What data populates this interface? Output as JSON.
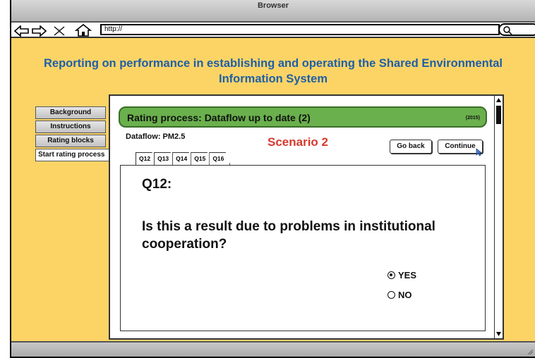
{
  "browser": {
    "title": "Browser",
    "url": "http://"
  },
  "page": {
    "heading": "Reporting on performance in establishing and operating the Shared Environmental Information System"
  },
  "sidebar": {
    "items": [
      {
        "label": "Background"
      },
      {
        "label": "Instructions"
      },
      {
        "label": "Rating blocks"
      },
      {
        "label": "Start rating process"
      }
    ]
  },
  "panel": {
    "banner_title": "Rating process: Dataflow up to date (2)",
    "banner_year": "(2015)",
    "dataflow": "Dataflow: PM2.5",
    "scenario": "Scenario 2",
    "go_back": "Go back",
    "continue": "Continue",
    "tabs": [
      "Q12",
      "Q13",
      "Q14",
      "Q15",
      "Q16"
    ],
    "question_label": "Q12:",
    "question_text": "Is this a result due to problems in institutional cooperation?",
    "options": [
      {
        "label": "YES",
        "selected": true
      },
      {
        "label": "NO",
        "selected": false
      }
    ]
  },
  "colors": {
    "page_bg": "#fcd466",
    "heading": "#1f5fa6",
    "banner": "#6ab04c",
    "scenario": "#d63a2f"
  },
  "icons": [
    "back-arrow-icon",
    "forward-arrow-icon",
    "close-icon",
    "home-icon",
    "search-icon",
    "scroll-up-icon",
    "scroll-down-icon",
    "cursor-icon",
    "resize-grip-icon"
  ]
}
